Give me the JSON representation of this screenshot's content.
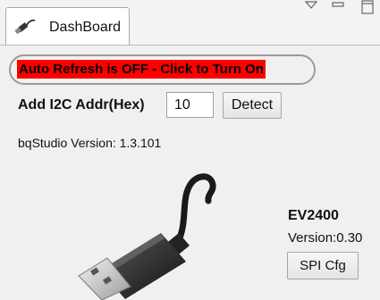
{
  "tab": {
    "title": "DashBoard",
    "icon": "usb-plug-icon"
  },
  "view_controls": {
    "menu_icon": "view-menu-triangle-icon",
    "minimize_icon": "minimize-icon",
    "maximize_icon": "maximize-icon"
  },
  "refresh": {
    "label": "Auto Refresh is OFF - Click to Turn On",
    "background_color": "#ff0000"
  },
  "address": {
    "label": "Add I2C Addr(Hex)",
    "value": "10",
    "detect_label": "Detect"
  },
  "software": {
    "version_line": "bqStudio Version:  1.3.101"
  },
  "device": {
    "image": "usb-cable-image",
    "name": "EV2400",
    "version_line": "Version:0.30",
    "spi_button_label": "SPI Cfg"
  }
}
